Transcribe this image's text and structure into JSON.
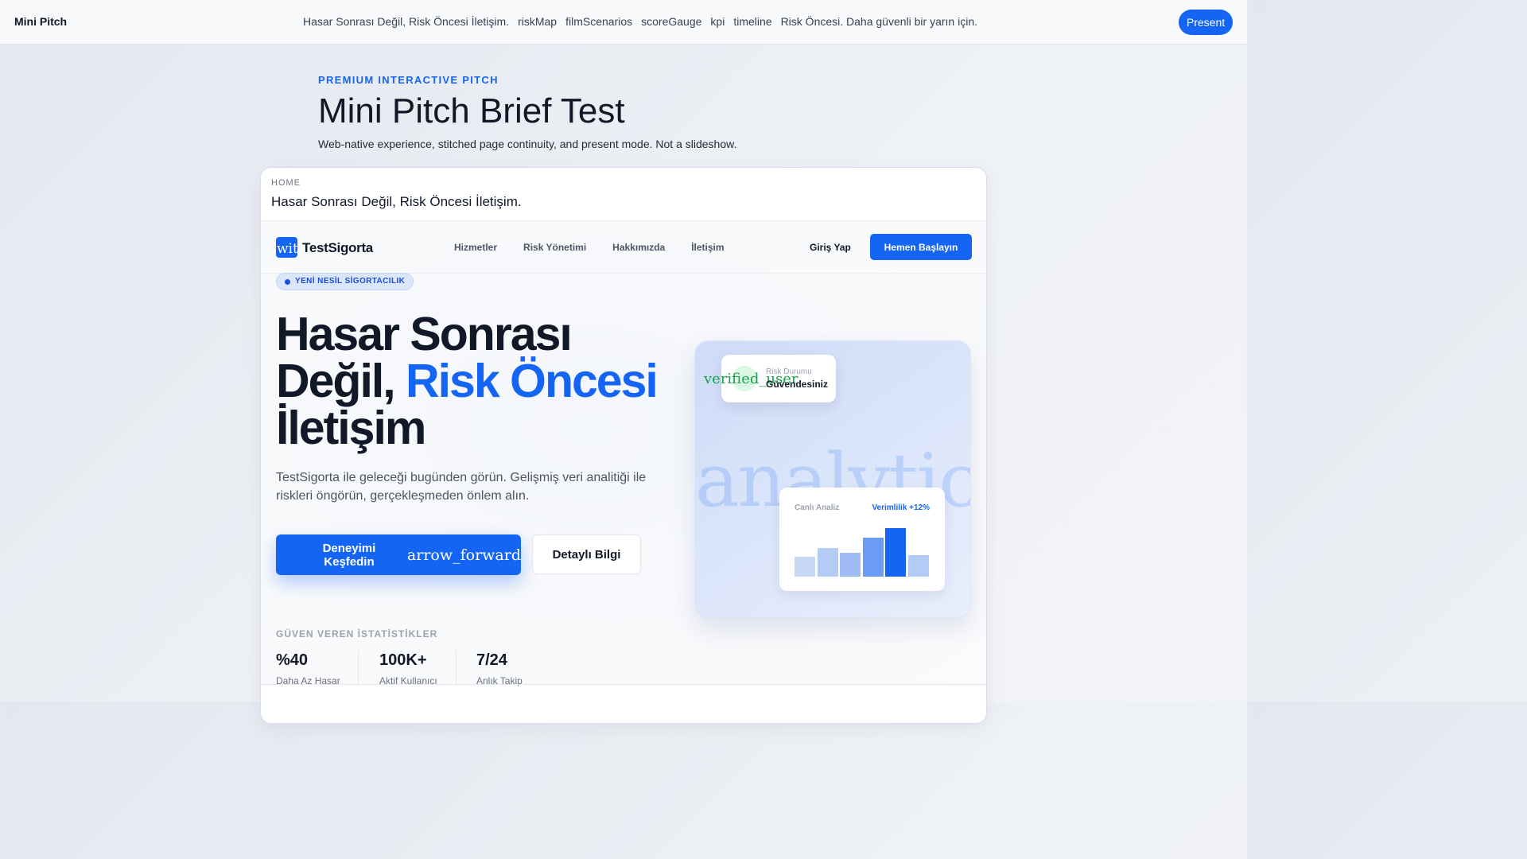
{
  "topbar": {
    "brand": "Mini Pitch",
    "nav": [
      "Hasar Sonrası Değil, Risk Öncesi İletişim.",
      "riskMap",
      "filmScenarios",
      "scoreGauge",
      "kpi",
      "timeline",
      "Risk Öncesi. Daha güvenli bir yarın için."
    ],
    "present_label": "Present"
  },
  "header": {
    "eyebrow": "PREMIUM INTERACTIVE PITCH",
    "title": "Mini Pitch Brief Test",
    "subtitle": "Web-native experience, stitched page continuity, and present mode. Not a slideshow."
  },
  "frame": {
    "crumb": "HOME",
    "title": "Hasar Sonrası Değil, Risk Öncesi İletişim."
  },
  "site": {
    "logo_icon_text": "wit",
    "logo_icon": "shield-icon",
    "logo_text": "TestSigorta",
    "nav": [
      "Hizmetler",
      "Risk Yönetimi",
      "Hakkımızda",
      "İletişim"
    ],
    "login_label": "Giriş Yap",
    "start_label": "Hemen Başlayın",
    "badge": "YENİ NESİL SİGORTACILIK",
    "hero": {
      "line1": "Hasar Sonrası",
      "line2_a": "Değil, ",
      "line2_b": "Risk Öncesi",
      "line3": "İletişim"
    },
    "lead": "TestSigorta ile geleceği bugünden görün. Gelişmiş veri analitiği ile riskleri öngörün, gerçekleşmeden önlem alın.",
    "explore_label": "Deneyimi Keşfedin",
    "explore_icon": "arrow_forward",
    "detail_label": "Detaylı Bilgi",
    "stats_label": "GÜVEN VEREN İSTATİSTİKLER",
    "stats": [
      {
        "value": "%40",
        "label": "Daha Az Hasar"
      },
      {
        "value": "100K+",
        "label": "Aktif Kullanıcı"
      },
      {
        "value": "7/24",
        "label": "Anlık Takip"
      }
    ],
    "visual": {
      "bg_icon": "analytics",
      "risk_icon": "verified_user",
      "risk_label": "Risk Durumu",
      "risk_value": "Güvendesiniz",
      "chart_label": "Canlı Analiz",
      "chart_eff": "Verimlilik +12%",
      "bar_levels": [
        0.38,
        0.55,
        0.46,
        0.74,
        0.93,
        0.41
      ],
      "bar_colors": [
        "#c7d8f7",
        "#b4cbf6",
        "#9fbdf4",
        "#6a9cf5",
        "#1565f5",
        "#b4cbf6"
      ]
    }
  },
  "colors": {
    "accent": "#1565f5",
    "success": "#16a34a"
  }
}
